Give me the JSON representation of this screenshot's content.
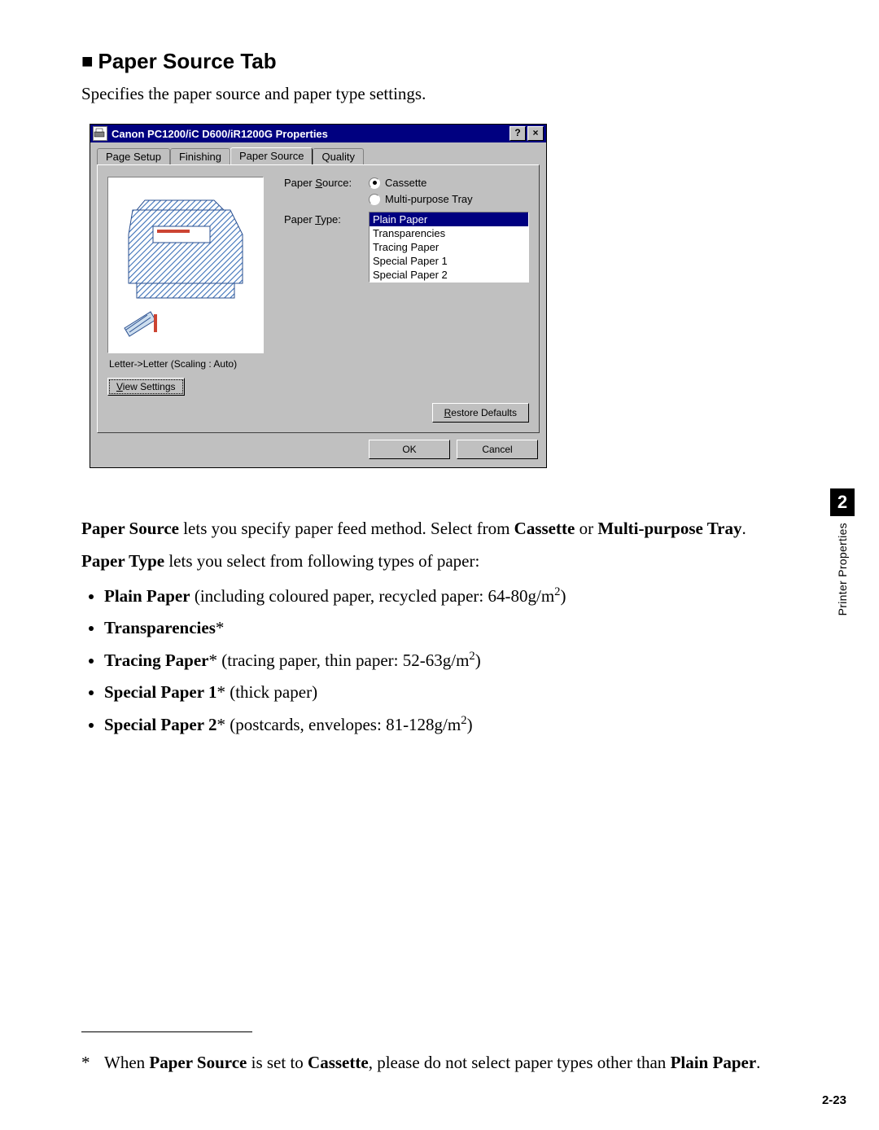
{
  "heading": "Paper Source Tab",
  "intro": "Specifies the paper source and paper type settings.",
  "dialog": {
    "title": "Canon PC1200/iC D600/iR1200G Properties",
    "help_btn": "?",
    "close_btn": "×",
    "tabs": [
      "Page Setup",
      "Finishing",
      "Paper Source",
      "Quality"
    ],
    "active_tab": 2,
    "labels": {
      "paper_source_pre": "Paper ",
      "paper_source_u": "S",
      "paper_source_post": "ource:",
      "paper_type_pre": "Paper ",
      "paper_type_u": "T",
      "paper_type_post": "ype:"
    },
    "radios": {
      "cassette": "Cassette",
      "multi": "Multi-purpose Tray",
      "selected": "cassette"
    },
    "paper_types": [
      "Plain Paper",
      "Transparencies",
      "Tracing Paper",
      "Special Paper 1",
      "Special Paper 2"
    ],
    "paper_type_selected": 0,
    "scaling_text": "Letter->Letter (Scaling : Auto)",
    "view_settings_u": "V",
    "view_settings_rest": "iew Settings",
    "restore_u": "R",
    "restore_rest": "estore Defaults",
    "ok": "OK",
    "cancel": "Cancel"
  },
  "body": {
    "p1_a": "Paper Source",
    "p1_b": " lets you specify paper feed method. Select from ",
    "p1_c": "Cassette",
    "p1_d": " or ",
    "p1_e": "Multi-purpose Tray",
    "p1_f": ".",
    "p2_a": "Paper Type",
    "p2_b": " lets you select from following types of paper:",
    "items": {
      "plain_a": "Plain Paper",
      "plain_b": " (including coloured paper, recycled paper: 64-80g/m",
      "plain_c": ")",
      "trans_a": "Transparencies",
      "trans_b": "*",
      "tracing_a": "Tracing Paper",
      "tracing_b": "* (tracing paper, thin paper: 52-63g/m",
      "tracing_c": ")",
      "sp1_a": "Special Paper 1",
      "sp1_b": "* (thick paper)",
      "sp2_a": "Special Paper 2",
      "sp2_b": "* (postcards, envelopes: 81-128g/m",
      "sp2_c": ")"
    }
  },
  "sidebar": {
    "badge": "2",
    "label": "Printer Properties"
  },
  "footnote": {
    "ast": "*",
    "text_a": "When ",
    "text_b": "Paper Source",
    "text_c": " is set to ",
    "text_d": "Cassette",
    "text_e": ", please do not select paper types other than ",
    "text_f": "Plain Paper",
    "text_g": "."
  },
  "page_num": "2-23"
}
